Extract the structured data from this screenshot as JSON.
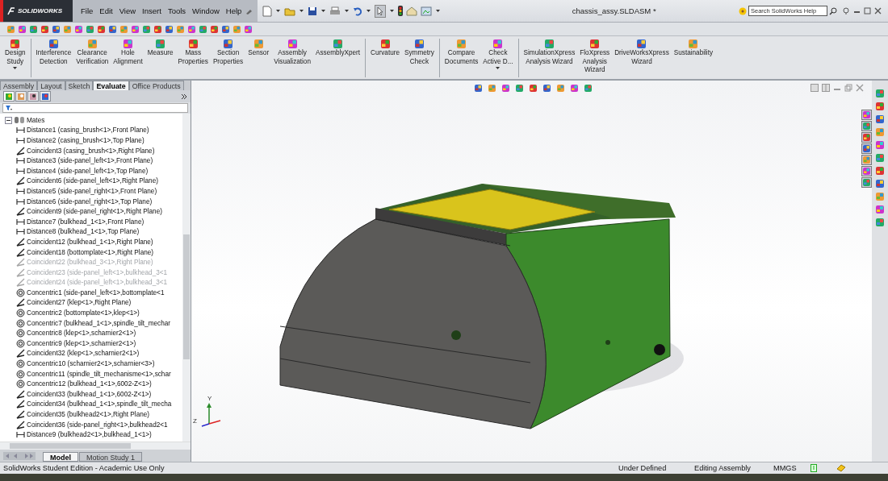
{
  "app": {
    "logo": "SOLIDWORKS"
  },
  "menu": [
    "File",
    "Edit",
    "View",
    "Insert",
    "Tools",
    "Window",
    "Help"
  ],
  "document_title": "chassis_assy.SLDASM *",
  "search": {
    "placeholder": "Search SolidWorks Help"
  },
  "ribbon_groups": [
    [
      {
        "label": "Design\nStudy",
        "dropdown": true
      }
    ],
    [
      {
        "label": "Interference\nDetection",
        "dropdown": false
      },
      {
        "label": "Clearance\nVerification",
        "dropdown": false
      },
      {
        "label": "Hole\nAlignment",
        "dropdown": false
      },
      {
        "label": "Measure",
        "dropdown": false
      },
      {
        "label": "Mass\nProperties",
        "dropdown": false
      },
      {
        "label": "Section\nProperties",
        "dropdown": false
      },
      {
        "label": "Sensor",
        "dropdown": false
      },
      {
        "label": "Assembly\nVisualization",
        "dropdown": false
      },
      {
        "label": "AssemblyXpert",
        "dropdown": false
      }
    ],
    [
      {
        "label": "Curvature",
        "dropdown": false
      },
      {
        "label": "Symmetry\nCheck",
        "dropdown": false
      }
    ],
    [
      {
        "label": "Compare\nDocuments",
        "dropdown": false
      },
      {
        "label": "Check\nActive D...",
        "dropdown": true
      }
    ],
    [
      {
        "label": "SimulationXpress\nAnalysis Wizard",
        "dropdown": false
      },
      {
        "label": "FloXpress\nAnalysis\nWizard",
        "dropdown": false
      },
      {
        "label": "DriveWorksXpress\nWizard",
        "dropdown": false
      },
      {
        "label": "Sustainability",
        "dropdown": false
      }
    ]
  ],
  "command_tabs": [
    {
      "label": "Assembly",
      "selected": false
    },
    {
      "label": "Layout",
      "selected": false
    },
    {
      "label": "Sketch",
      "selected": false
    },
    {
      "label": "Evaluate",
      "selected": true
    },
    {
      "label": "Office Products",
      "selected": false
    }
  ],
  "panel_tabs": [
    {
      "selected": true
    },
    {
      "selected": false
    },
    {
      "selected": false
    },
    {
      "selected": false
    }
  ],
  "feature_tree": {
    "label": "Mates",
    "expanded": true,
    "children": [
      {
        "label": "Distance1 (casing_brush<1>,Front Plane)",
        "kind": "distance",
        "suppressed": false
      },
      {
        "label": "Distance2 (casing_brush<1>,Top Plane)",
        "kind": "distance",
        "suppressed": false
      },
      {
        "label": "Coincident3 (casing_brush<1>,Right Plane)",
        "kind": "coincident",
        "suppressed": false
      },
      {
        "label": "Distance3 (side-panel_left<1>,Front Plane)",
        "kind": "distance",
        "suppressed": false
      },
      {
        "label": "Distance4 (side-panel_left<1>,Top Plane)",
        "kind": "distance",
        "suppressed": false
      },
      {
        "label": "Coincident6 (side-panel_left<1>,Right Plane)",
        "kind": "coincident",
        "suppressed": false
      },
      {
        "label": "Distance5 (side-panel_right<1>,Front Plane)",
        "kind": "distance",
        "suppressed": false
      },
      {
        "label": "Distance6 (side-panel_right<1>,Top Plane)",
        "kind": "distance",
        "suppressed": false
      },
      {
        "label": "Coincident9 (side-panel_right<1>,Right Plane)",
        "kind": "coincident",
        "suppressed": false
      },
      {
        "label": "Distance7 (bulkhead_1<1>,Front Plane)",
        "kind": "distance",
        "suppressed": false
      },
      {
        "label": "Distance8 (bulkhead_1<1>,Top Plane)",
        "kind": "distance",
        "suppressed": false
      },
      {
        "label": "Coincident12 (bulkhead_1<1>,Right Plane)",
        "kind": "coincident",
        "suppressed": false
      },
      {
        "label": "Coincident18 (bottomplate<1>,Right Plane)",
        "kind": "coincident",
        "suppressed": false
      },
      {
        "label": "Coincident22 (bulkhead_3<1>,Right Plane)",
        "kind": "coincident",
        "suppressed": true
      },
      {
        "label": "Coincident23 (side-panel_left<1>,bulkhead_3<1",
        "kind": "coincident",
        "suppressed": true
      },
      {
        "label": "Coincident24 (side-panel_left<1>,bulkhead_3<1",
        "kind": "coincident",
        "suppressed": true
      },
      {
        "label": "Concentric1 (side-panel_left<1>,bottomplate<1",
        "kind": "concentric",
        "suppressed": false
      },
      {
        "label": "Coincident27 (klep<1>,Right Plane)",
        "kind": "coincident",
        "suppressed": false
      },
      {
        "label": "Concentric2 (bottomplate<1>,klep<1>)",
        "kind": "concentric",
        "suppressed": false
      },
      {
        "label": "Concentric7 (bulkhead_1<1>,spindle_tilt_mechar",
        "kind": "concentric",
        "suppressed": false
      },
      {
        "label": "Concentric8 (klep<1>,scharnier2<1>)",
        "kind": "concentric",
        "suppressed": false
      },
      {
        "label": "Concentric9 (klep<1>,scharnier2<1>)",
        "kind": "concentric",
        "suppressed": false
      },
      {
        "label": "Coincident32 (klep<1>,scharnier2<1>)",
        "kind": "coincident",
        "suppressed": false
      },
      {
        "label": "Concentric10 (scharnier2<1>,scharnier<3>)",
        "kind": "concentric",
        "suppressed": false
      },
      {
        "label": "Concentric11 (spindle_tilt_mechanisme<1>,schar",
        "kind": "concentric",
        "suppressed": false
      },
      {
        "label": "Concentric12 (bulkhead_1<1>,6002-Z<1>)",
        "kind": "concentric",
        "suppressed": false
      },
      {
        "label": "Coincident33 (bulkhead_1<1>,6002-Z<1>)",
        "kind": "coincident",
        "suppressed": false
      },
      {
        "label": "Coincident34 (bulkhead_1<1>,spindle_tilt_mecha",
        "kind": "coincident",
        "suppressed": false
      },
      {
        "label": "Coincident35 (bulkhead2<1>,Right Plane)",
        "kind": "coincident",
        "suppressed": false
      },
      {
        "label": "Coincident36 (side-panel_right<1>,bulkhead2<1",
        "kind": "coincident",
        "suppressed": false
      },
      {
        "label": "Distance9 (bulkhead2<1>,bulkhead_1<1>)",
        "kind": "distance",
        "suppressed": false
      }
    ]
  },
  "bottom_tabs": [
    {
      "label": "Model",
      "selected": true
    },
    {
      "label": "Motion Study 1",
      "selected": false
    }
  ],
  "triad": {
    "labels": [
      "Y",
      "Z"
    ]
  },
  "status_bar": {
    "edition": "SolidWorks Student Edition - Academic Use Only",
    "state": "Under Defined",
    "mode": "Editing Assembly",
    "units": "MMGS"
  }
}
